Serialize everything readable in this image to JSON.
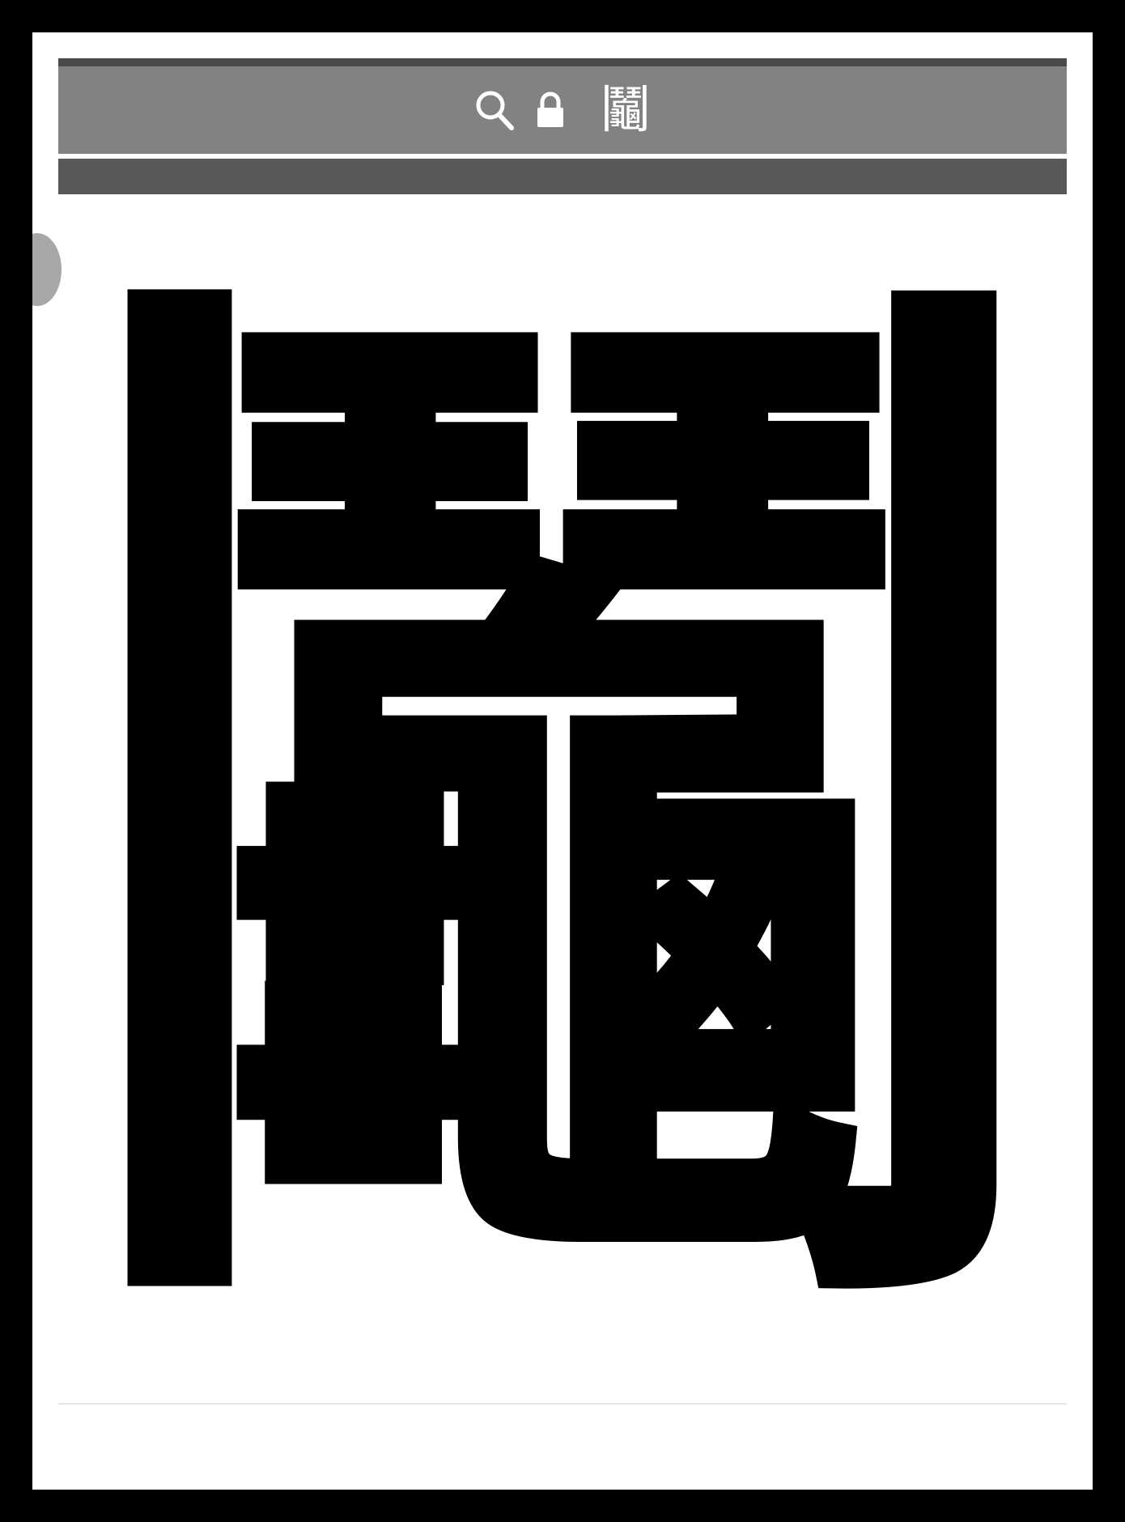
{
  "toolbar": {
    "search_icon": "search-icon",
    "lock_icon": "lock-icon",
    "title": "鬮"
  },
  "main": {
    "glyph": "鬮"
  },
  "colors": {
    "toolbar_bg": "#828282",
    "subbar_bg": "#585858",
    "frame_border": "#000000",
    "glyph": "#000000"
  }
}
